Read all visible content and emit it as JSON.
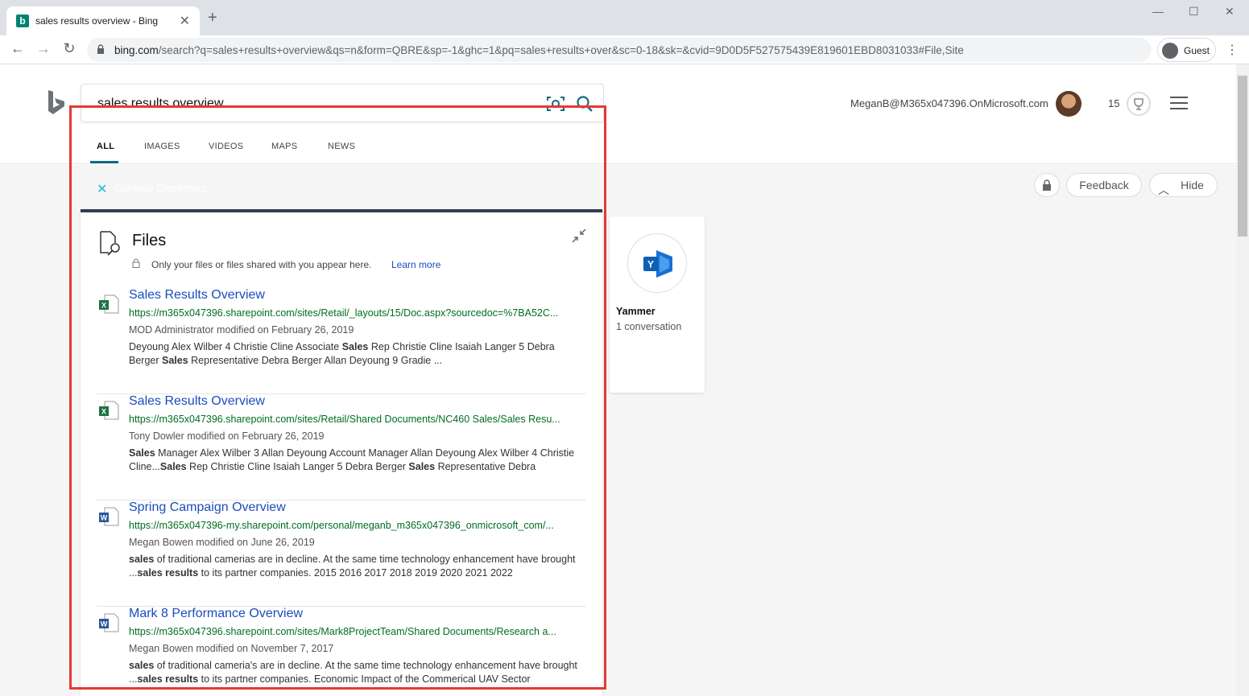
{
  "browser": {
    "tab_title": "sales results overview - Bing",
    "url_host": "bing.com",
    "url_rest": "/search?q=sales+results+overview&qs=n&form=QBRE&sp=-1&ghc=1&pq=sales+results+over&sc=0-18&sk=&cvid=9D0D5F527575439E819601EBD8031033#File,Site",
    "profile_label": "Guest"
  },
  "header": {
    "search_query": "sales results overview",
    "account": "MeganB@M365x047396.OnMicrosoft.com",
    "reward_points": "15"
  },
  "scopes": [
    "ALL",
    "IMAGES",
    "VIDEOS",
    "MAPS",
    "NEWS"
  ],
  "org": {
    "name": "Contoso Electronics",
    "accent": "#16c0c8"
  },
  "actions": {
    "feedback": "Feedback",
    "hide": "Hide"
  },
  "files": {
    "title": "Files",
    "privacy_note": "Only your files or files shared with you appear here.",
    "learn_more": "Learn more",
    "results": [
      {
        "type": "excel",
        "title": "Sales Results Overview",
        "url": "https://m365x047396.sharepoint.com/sites/Retail/_layouts/15/Doc.aspx?sourcedoc=%7BA52C...",
        "meta": "MOD Administrator modified on February 26, 2019",
        "snippet": "Deyoung Alex Wilber 4 Christie Cline Associate <b>Sales</b> Rep Christie Cline Isaiah Langer 5 Debra Berger <b>Sales</b> Representative Debra Berger Allan Deyoung 9 Gradie ..."
      },
      {
        "type": "excel",
        "title": "Sales Results Overview",
        "url": "https://m365x047396.sharepoint.com/sites/Retail/Shared Documents/NC460 Sales/Sales Resu...",
        "meta": "Tony Dowler modified on February 26, 2019",
        "snippet": "<b>Sales</b> Manager Alex Wilber 3 Allan Deyoung Account Manager Allan Deyoung Alex Wilber 4 Christie Cline...<b>Sales</b> Rep Christie Cline Isaiah Langer 5 Debra Berger <b>Sales</b> Representative Debra"
      },
      {
        "type": "word",
        "title": "Spring Campaign Overview",
        "url": "https://m365x047396-my.sharepoint.com/personal/meganb_m365x047396_onmicrosoft_com/...",
        "meta": "Megan Bowen modified on June 26, 2019",
        "snippet": "<b>sales</b> of traditional camerias are in decline. At the same time technology enhancement have brought ...<b>sales results</b> to its partner companies. 2015 2016 2017 2018 2019 2020 2021 2022"
      },
      {
        "type": "word",
        "title": "Mark 8 Performance Overview",
        "url": "https://m365x047396.sharepoint.com/sites/Mark8ProjectTeam/Shared Documents/Research a...",
        "meta": "Megan Bowen modified on November 7, 2017",
        "snippet": "<b>sales</b> of traditional cameria's are in decline. At the same time technology enhancement have brought ...<b>sales results</b> to its partner companies. Economic Impact of the Commerical UAV Sector"
      }
    ]
  },
  "yammer": {
    "title": "Yammer",
    "subtitle": "1 conversation"
  }
}
